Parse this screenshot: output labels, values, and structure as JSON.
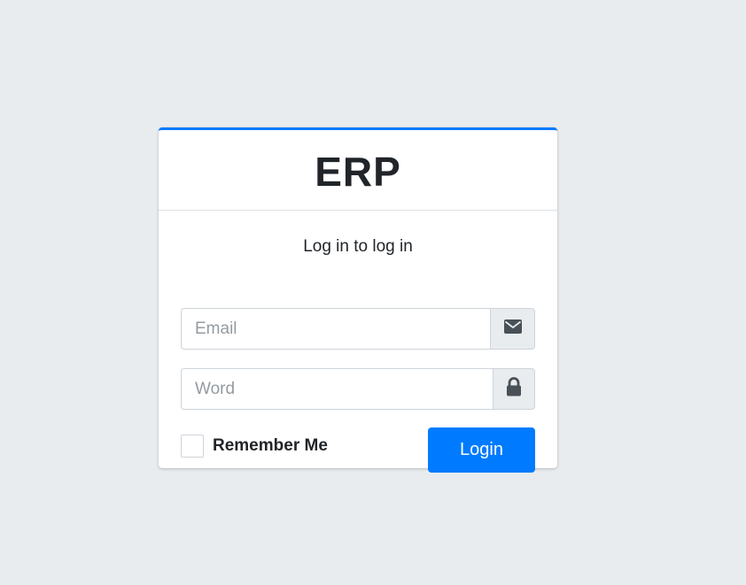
{
  "brand": {
    "title": "ERP"
  },
  "login": {
    "message": "Log in to log in",
    "email": {
      "value": "",
      "placeholder": "Email",
      "icon": "envelope-icon"
    },
    "password": {
      "value": "",
      "placeholder": "Word",
      "icon": "lock-icon"
    },
    "remember": {
      "label": "Remember Me",
      "checked": false
    },
    "submit_label": "Login"
  },
  "colors": {
    "background": "#e9ecef",
    "accent": "#007bff",
    "card": "#ffffff",
    "icon": "#495057"
  }
}
